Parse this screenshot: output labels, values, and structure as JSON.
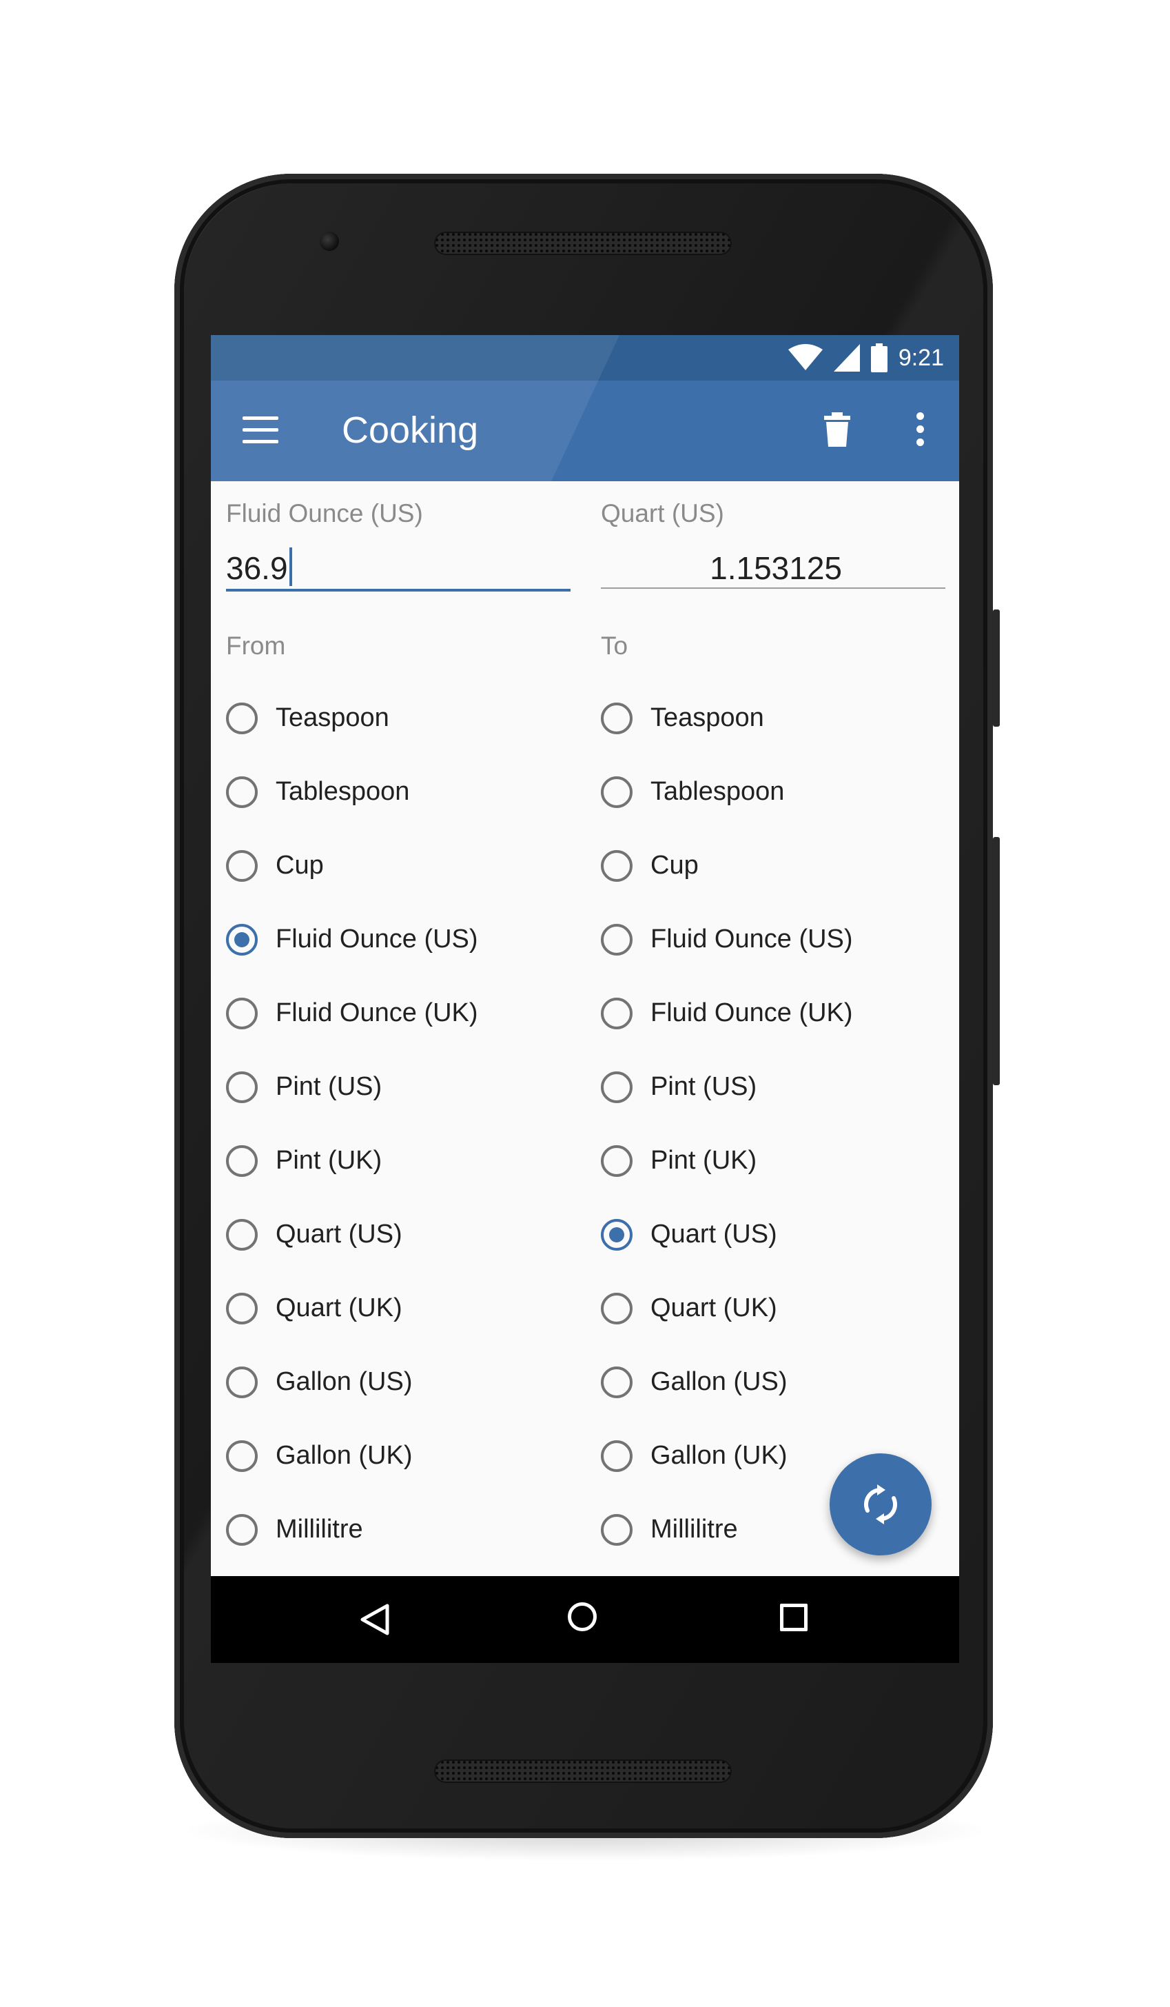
{
  "status_bar": {
    "time": "9:21"
  },
  "app_bar": {
    "title": "Cooking"
  },
  "from_field": {
    "label": "Fluid Ounce (US)",
    "value": "36.9"
  },
  "to_field": {
    "label": "Quart (US)",
    "value": "1.153125"
  },
  "from_section": {
    "label": "From",
    "selected": "Fluid Ounce (US)"
  },
  "to_section": {
    "label": "To",
    "selected": "Quart (US)"
  },
  "units": [
    "Teaspoon",
    "Tablespoon",
    "Cup",
    "Fluid Ounce (US)",
    "Fluid Ounce (UK)",
    "Pint (US)",
    "Pint (UK)",
    "Quart (US)",
    "Quart (UK)",
    "Gallon (US)",
    "Gallon (UK)",
    "Millilitre"
  ],
  "colors": {
    "primary": "#3d6faa",
    "primary_dark": "#2f5f93",
    "background": "#fafafa",
    "text": "#212121",
    "hint": "#8a8a8a"
  },
  "icons": {
    "menu": "hamburger-menu-icon",
    "delete": "trash-icon",
    "more": "more-vert-icon",
    "swap": "swap-refresh-icon",
    "wifi": "wifi-icon",
    "signal": "cell-signal-icon",
    "battery": "battery-icon",
    "back": "back-triangle-icon",
    "home": "home-circle-icon",
    "recents": "recents-square-icon"
  }
}
